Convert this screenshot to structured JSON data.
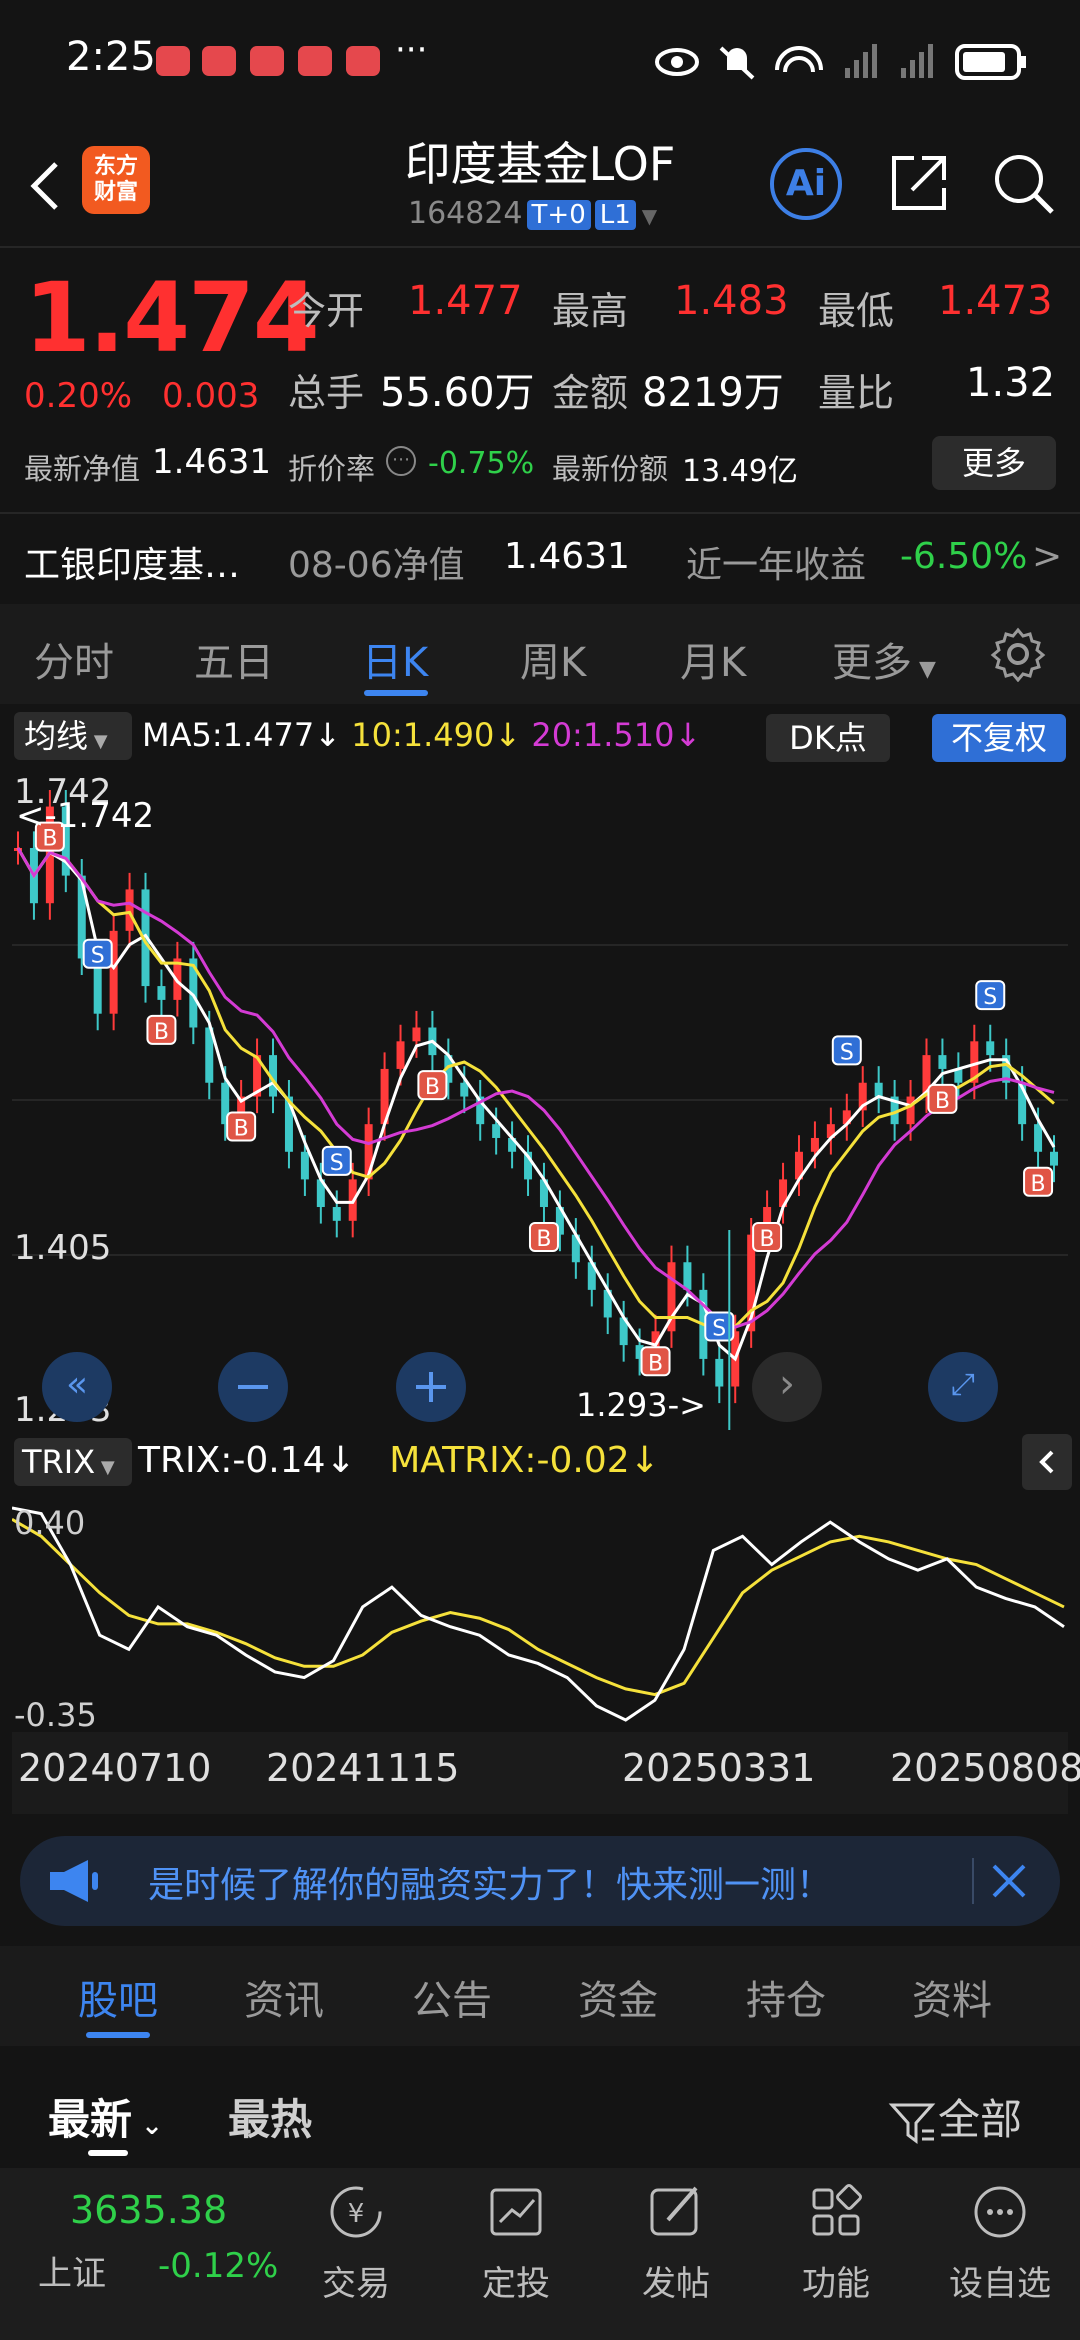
{
  "status_bar": {
    "time": "2:25",
    "dots": "···"
  },
  "header": {
    "logo_line1": "东方",
    "logo_line2": "财富",
    "title": "印度基金LOF",
    "code": "164824",
    "tag1": "T+0",
    "tag2": "L1",
    "ai_label": "Ai"
  },
  "quote": {
    "price": "1.474",
    "change_pct": "0.20%",
    "change_abs": "0.003",
    "open_label": "今开",
    "open": "1.477",
    "high_label": "最高",
    "high": "1.483",
    "low_label": "最低",
    "low": "1.473",
    "volume_label": "总手",
    "volume": "55.60万",
    "amount_label": "金额",
    "amount": "8219万",
    "ratio_label": "量比",
    "ratio": "1.32",
    "nav_label": "最新净值",
    "nav": "1.4631",
    "discount_label": "折价率",
    "discount": "-0.75%",
    "shares_label": "最新份额",
    "shares": "13.49亿",
    "more_label": "更多"
  },
  "fund_row": {
    "name": "工银印度基…",
    "nav_date_label": "08-06净值",
    "nav_value": "1.4631",
    "yield_label": "近一年收益",
    "yield_value": "-6.50%",
    "arrow": ">"
  },
  "tabs": [
    "分时",
    "五日",
    "日K",
    "周K",
    "月K",
    "更多"
  ],
  "ma_bar": {
    "button": "均线",
    "ma5": "MA5:1.477",
    "ma10": "10:1.490",
    "ma20": "20:1.510",
    "down_arrow": "↓",
    "dk_label": "DK点",
    "fq_label": "不复权",
    "colors": {
      "ma5": "#ffffff",
      "ma10": "#f5e13b",
      "ma20": "#d43bd4"
    }
  },
  "main_chart": {
    "y_labels": [
      "1.742",
      "1.405",
      "1.293"
    ],
    "max_marker": "<-1.742",
    "min_marker": "1.293->"
  },
  "trix_bar": {
    "button": "TRIX",
    "trix": "TRIX:-0.14",
    "matrix": "MATRIX:-0.02",
    "arrow": "↓",
    "y_labels": [
      "0.40",
      "-0.35"
    ]
  },
  "dates": [
    "20240710",
    "20241115",
    "20250331",
    "20250808"
  ],
  "ad_text": "是时候了解你的融资实力了！快来测一测！",
  "bottom_tabs": [
    "股吧",
    "资讯",
    "公告",
    "资金",
    "持仓",
    "资料"
  ],
  "sort": {
    "latest": "最新",
    "hot": "最热",
    "filter": "全部"
  },
  "navbar": {
    "index_value": "3635.38",
    "index_name": "上证",
    "index_change": "-0.12%",
    "items": [
      "交易",
      "定投",
      "发帖",
      "功能",
      "设自选"
    ]
  },
  "chart_data": {
    "type": "line",
    "y_range": [
      1.293,
      1.742
    ],
    "x_ticks": [
      "20240710",
      "20241115",
      "20250331",
      "20250808"
    ],
    "series": [
      {
        "name": "MA5",
        "color": "#ffffff"
      },
      {
        "name": "10",
        "color": "#f5e13b"
      },
      {
        "name": "20",
        "color": "#d43bd4"
      }
    ],
    "close": [
      1.7,
      1.66,
      1.73,
      1.68,
      1.62,
      1.58,
      1.64,
      1.67,
      1.6,
      1.59,
      1.62,
      1.57,
      1.53,
      1.5,
      1.52,
      1.55,
      1.52,
      1.48,
      1.46,
      1.44,
      1.43,
      1.46,
      1.5,
      1.54,
      1.56,
      1.57,
      1.55,
      1.53,
      1.52,
      1.5,
      1.49,
      1.48,
      1.46,
      1.44,
      1.42,
      1.4,
      1.38,
      1.36,
      1.34,
      1.33,
      1.35,
      1.4,
      1.38,
      1.33,
      1.31,
      1.35,
      1.42,
      1.44,
      1.46,
      1.48,
      1.49,
      1.5,
      1.51,
      1.53,
      1.52,
      1.5,
      1.52,
      1.55,
      1.54,
      1.53,
      1.56,
      1.55,
      1.53,
      1.5,
      1.48,
      1.47
    ],
    "trix_range": [
      -0.35,
      0.4
    ]
  }
}
